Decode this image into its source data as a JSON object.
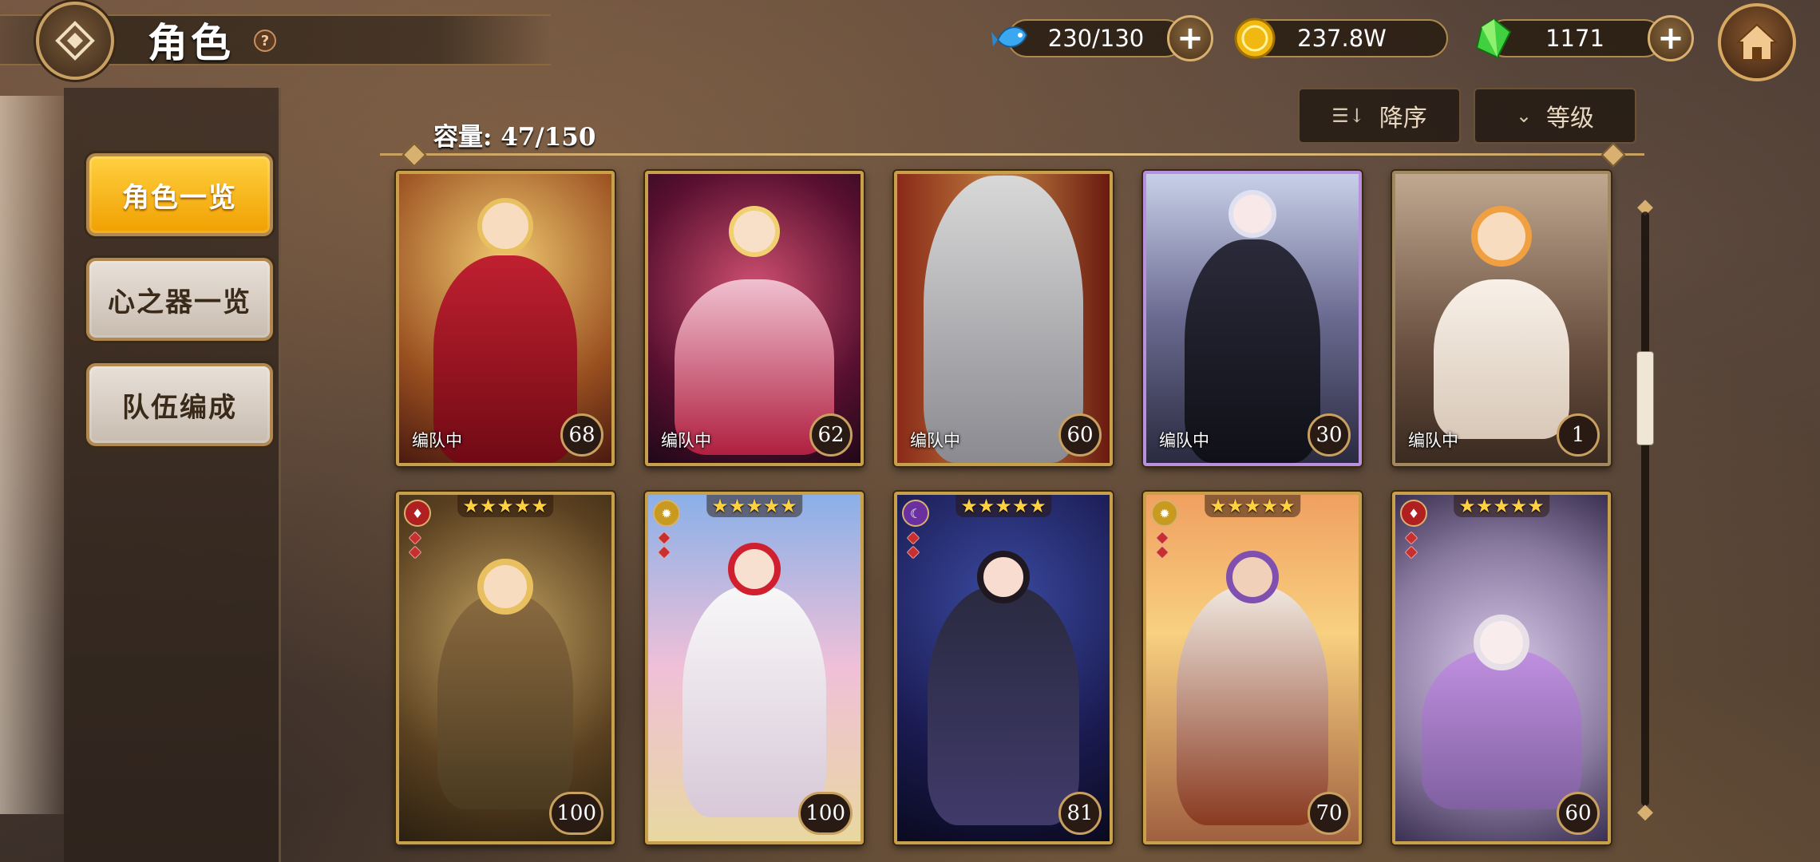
{
  "header": {
    "title": "角色",
    "help_symbol": "?",
    "back_icon": "back-diamond-icon",
    "home_icon": "home-icon"
  },
  "currencies": [
    {
      "name": "stamina",
      "icon": "blue-fish-icon",
      "value": "230/130",
      "has_plus": true
    },
    {
      "name": "gold",
      "icon": "gold-coin-icon",
      "value": "237.8W",
      "has_plus": false
    },
    {
      "name": "gems",
      "icon": "green-crystal-icon",
      "value": "1171",
      "has_plus": true
    }
  ],
  "sidebar": {
    "items": [
      {
        "label": "角色一览",
        "active": true
      },
      {
        "label": "心之器一览",
        "active": false
      },
      {
        "label": "队伍编成",
        "active": false
      }
    ]
  },
  "controls": {
    "capacity": "容量: 47/150",
    "sort_label": "降序",
    "sort_icon": "sort-desc-icon",
    "filter_label": "等级",
    "filter_icon": "chevron-down-icon"
  },
  "cards_row1": [
    {
      "status": "编队中",
      "level": "68",
      "theme": "crimson"
    },
    {
      "status": "编队中",
      "level": "62",
      "theme": "rose"
    },
    {
      "status": "编队中",
      "level": "60",
      "theme": "knight"
    },
    {
      "status": "编队中",
      "level": "30",
      "theme": "gothic"
    },
    {
      "status": "编队中",
      "level": "1",
      "theme": "catgirl"
    }
  ],
  "cards_row2": [
    {
      "level": "100",
      "stars": "★★★★★",
      "element": "fire",
      "theme": "detective"
    },
    {
      "level": "100",
      "stars": "★★★★★",
      "element": "light",
      "theme": "shrine"
    },
    {
      "level": "81",
      "stars": "★★★★★",
      "element": "dark",
      "theme": "night"
    },
    {
      "level": "70",
      "stars": "★★★★★",
      "element": "light",
      "theme": "sunset"
    },
    {
      "level": "60",
      "stars": "★★★★★",
      "element": "fire",
      "theme": "dream"
    }
  ],
  "colors": {
    "accent_gold": "#c8a04c",
    "active_button": "#f0a000"
  }
}
